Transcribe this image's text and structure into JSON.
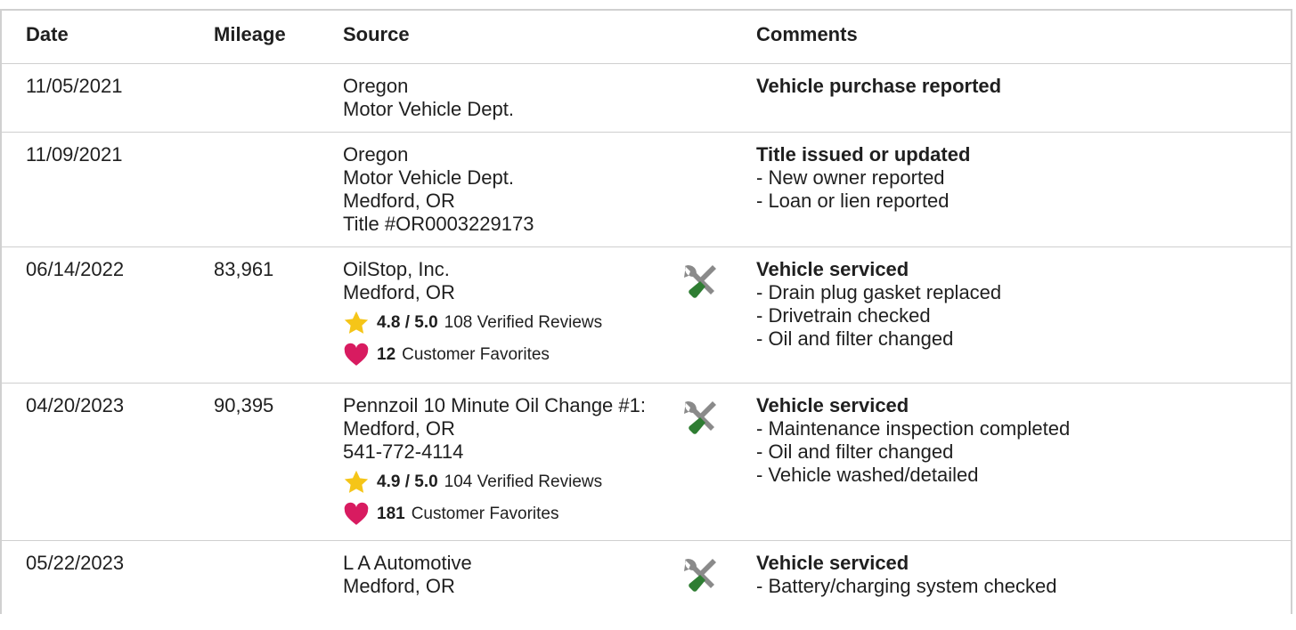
{
  "headers": {
    "date": "Date",
    "mileage": "Mileage",
    "source": "Source",
    "comments": "Comments"
  },
  "rows": [
    {
      "date": "11/05/2021",
      "mileage": "",
      "source": [
        "Oregon",
        "Motor Vehicle Dept."
      ],
      "comment_title": "Vehicle purchase reported",
      "comment_items": []
    },
    {
      "date": "11/09/2021",
      "mileage": "",
      "source": [
        "Oregon",
        "Motor Vehicle Dept.",
        "Medford, OR",
        "Title #OR0003229173"
      ],
      "comment_title": "Title issued or updated",
      "comment_items": [
        "- New owner reported",
        "- Loan or lien reported"
      ]
    },
    {
      "date": "06/14/2022",
      "mileage": "83,961",
      "source": [
        "OilStop, Inc.",
        "Medford, OR"
      ],
      "rating": "4.8 / 5.0",
      "reviews": "108 Verified Reviews",
      "favorites_count": "12",
      "favorites_label": "Customer Favorites",
      "icon": "service-wrench-screwdriver-icon",
      "comment_title": "Vehicle serviced",
      "comment_items": [
        "- Drain plug gasket replaced",
        "- Drivetrain checked",
        "- Oil and filter changed"
      ]
    },
    {
      "date": "04/20/2023",
      "mileage": "90,395",
      "source": [
        "Pennzoil 10 Minute Oil Change #1:",
        "Medford, OR",
        "541-772-4114"
      ],
      "rating": "4.9 / 5.0",
      "reviews": "104 Verified Reviews",
      "favorites_count": "181",
      "favorites_label": "Customer Favorites",
      "icon": "service-wrench-screwdriver-icon",
      "comment_title": "Vehicle serviced",
      "comment_items": [
        "- Maintenance inspection completed",
        "- Oil and filter changed",
        "- Vehicle washed/detailed"
      ]
    },
    {
      "date": "05/22/2023",
      "mileage": "",
      "source": [
        "L A Automotive",
        "Medford, OR"
      ],
      "icon": "service-wrench-screwdriver-icon",
      "comment_title": "Vehicle serviced",
      "comment_items": [
        "- Battery/charging system checked"
      ]
    }
  ],
  "colors": {
    "star": "#f5c518",
    "heart": "#d81b60",
    "tool_gray": "#8a8a8a",
    "tool_green": "#2e7d32",
    "border": "#cfcfcf"
  }
}
